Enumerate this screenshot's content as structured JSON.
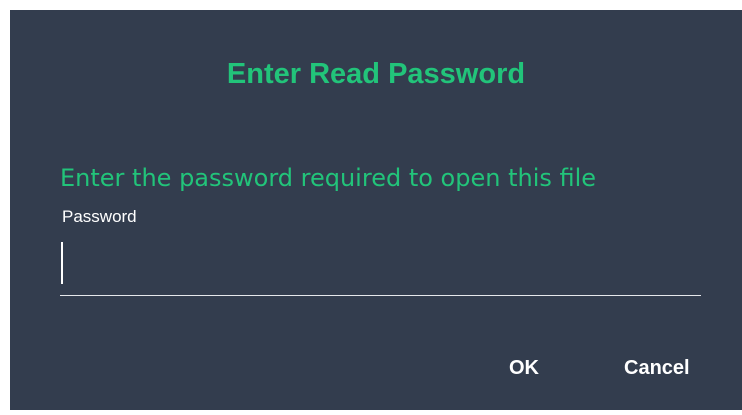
{
  "dialog": {
    "title": "Enter Read Password",
    "message": "Enter the password required to open this file",
    "password_label": "Password",
    "password_value": "",
    "ok_label": "OK",
    "cancel_label": "Cancel"
  },
  "colors": {
    "background": "#333d4e",
    "accent": "#22c47a",
    "text": "#ffffff"
  }
}
